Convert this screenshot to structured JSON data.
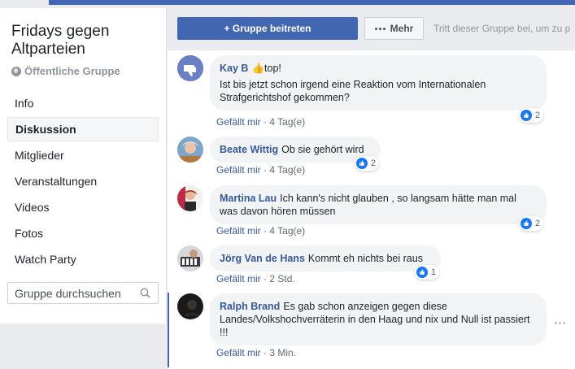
{
  "group": {
    "title": "Fridays gegen Altparteien",
    "type": "Öffentliche Gruppe"
  },
  "nav": [
    {
      "label": "Info"
    },
    {
      "label": "Diskussion",
      "active": true
    },
    {
      "label": "Mitglieder"
    },
    {
      "label": "Veranstaltungen"
    },
    {
      "label": "Videos"
    },
    {
      "label": "Fotos"
    },
    {
      "label": "Watch Party"
    }
  ],
  "search": {
    "placeholder": "Gruppe durchsuchen"
  },
  "toolbar": {
    "join_label": "+ Gruppe beitreten",
    "more_label": "Mehr",
    "hint": "Tritt dieser Gruppe bei, um zu p"
  },
  "comments": [
    {
      "author": "Kay B",
      "emoji": "👍",
      "text": "top!",
      "text2": "Ist bis jetzt schon irgend eine Reaktion vom Internationalen Strafgerichtshof gekommen?",
      "like": "Gefällt mir",
      "time": "4 Tag(e)",
      "reactions": "2"
    },
    {
      "author": "Beate Wittig",
      "text": "Ob sie gehört wird",
      "like": "Gefällt mir",
      "time": "4 Tag(e)",
      "reactions": "2"
    },
    {
      "author": "Martina Lau",
      "text": "Ich kann's nicht glauben , so langsam hätte man mal was davon hören müssen",
      "like": "Gefällt mir",
      "time": "4 Tag(e)",
      "reactions": "2"
    },
    {
      "author": "Jörg Van de Hans",
      "text": "Kommt eh nichts bei raus",
      "like": "Gefällt mir",
      "time": "2 Std.",
      "reactions": "1"
    },
    {
      "author": "Ralph Brand",
      "text": "Es gab schon anzeigen gegen diese Landes/Volkshochverräterin in den Haag und nix und Null ist passiert !!!",
      "like": "Gefällt mir",
      "time": "3 Min."
    }
  ],
  "colors": {
    "brand": "#4267b2",
    "link": "#385898",
    "like_blue": "#1877f2"
  }
}
